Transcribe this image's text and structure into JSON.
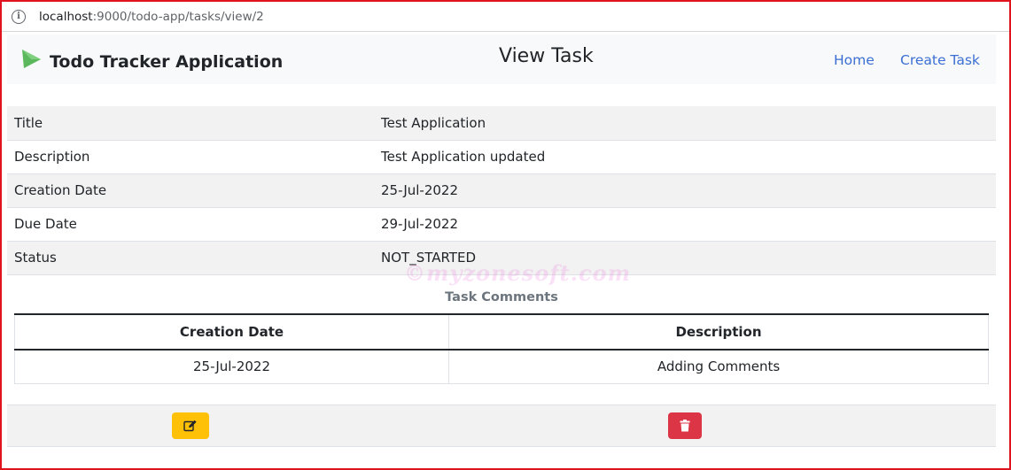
{
  "browser": {
    "url_host": "localhost",
    "url_path": ":9000/todo-app/tasks/view/2"
  },
  "navbar": {
    "brand": "Todo Tracker Application",
    "page_title": "View Task",
    "links": {
      "home": "Home",
      "create_task": "Create Task"
    }
  },
  "task": {
    "rows": [
      {
        "label": "Title",
        "value": "Test Application"
      },
      {
        "label": "Description",
        "value": "Test Application updated"
      },
      {
        "label": "Creation Date",
        "value": "25-Jul-2022"
      },
      {
        "label": "Due Date",
        "value": "29-Jul-2022"
      },
      {
        "label": "Status",
        "value": "NOT_STARTED"
      }
    ]
  },
  "comments": {
    "title": "Task Comments",
    "headers": [
      "Creation Date",
      "Description"
    ],
    "rows": [
      {
        "creation_date": "25-Jul-2022",
        "description": "Adding Comments"
      }
    ]
  },
  "watermark": "©myzonesoft.com",
  "colors": {
    "brand_arrow": "#5cb85c",
    "link": "#3b6fd4",
    "edit_button": "#ffc107",
    "delete_button": "#dc3545",
    "frame": "#e0141e"
  },
  "icons": {
    "url_info": "info-icon",
    "brand": "play-arrow-icon",
    "edit": "edit-icon",
    "delete": "trash-icon"
  }
}
